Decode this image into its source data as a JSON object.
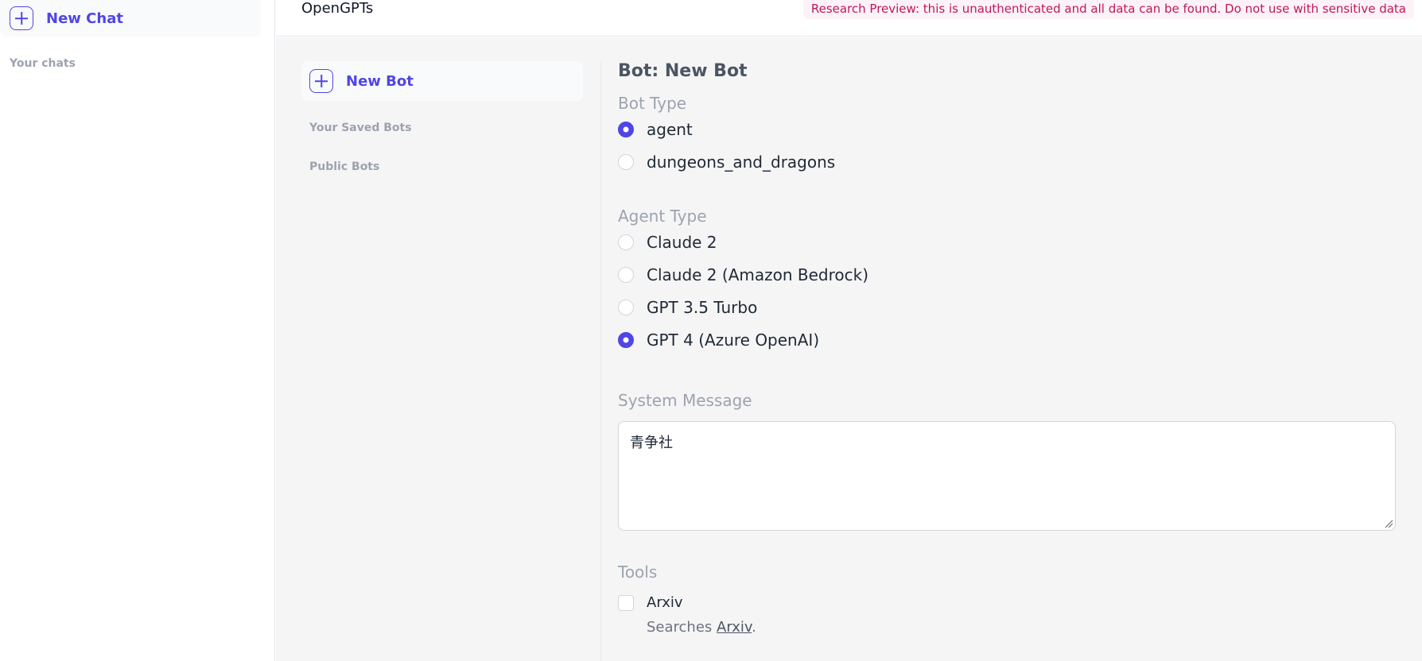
{
  "sidebar": {
    "new_chat_label": "New Chat",
    "your_chats_label": "Your chats"
  },
  "header": {
    "title": "OpenGPTs",
    "banner": "Research Preview: this is unauthenticated and all data can be found. Do not use with sensitive data"
  },
  "bots_panel": {
    "new_bot_label": "New Bot",
    "saved_bots_label": "Your Saved Bots",
    "public_bots_label": "Public Bots"
  },
  "form": {
    "title": "Bot: New Bot",
    "bot_type": {
      "label": "Bot Type",
      "options": [
        {
          "label": "agent",
          "checked": true
        },
        {
          "label": "dungeons_and_dragons",
          "checked": false
        }
      ]
    },
    "agent_type": {
      "label": "Agent Type",
      "options": [
        {
          "label": "Claude 2",
          "checked": false
        },
        {
          "label": "Claude 2 (Amazon Bedrock)",
          "checked": false
        },
        {
          "label": "GPT 3.5 Turbo",
          "checked": false
        },
        {
          "label": "GPT 4 (Azure OpenAI)",
          "checked": true
        }
      ]
    },
    "system_message": {
      "label": "System Message",
      "value": "青争社"
    },
    "tools": {
      "label": "Tools",
      "items": [
        {
          "label": "Arxiv",
          "checked": false,
          "desc_prefix": "Searches ",
          "desc_link": "Arxiv",
          "desc_suffix": "."
        }
      ]
    }
  },
  "colors": {
    "accent": "#4f46e5",
    "banner_bg": "#fdf2f8",
    "banner_text": "#be185d"
  }
}
